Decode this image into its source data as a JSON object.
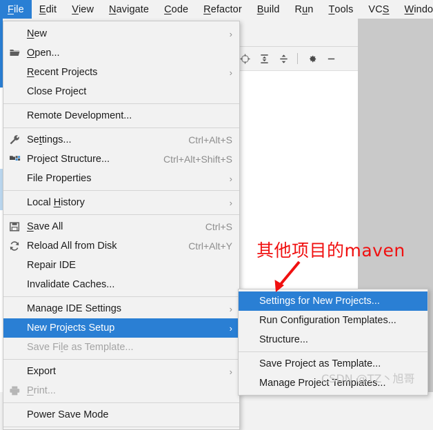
{
  "menubar": {
    "items": [
      {
        "label": "File",
        "mnemonic": "F",
        "active": true
      },
      {
        "label": "Edit",
        "mnemonic": "E",
        "active": false
      },
      {
        "label": "View",
        "mnemonic": "V",
        "active": false
      },
      {
        "label": "Navigate",
        "mnemonic": "N",
        "active": false
      },
      {
        "label": "Code",
        "mnemonic": "C",
        "active": false
      },
      {
        "label": "Refactor",
        "mnemonic": "R",
        "active": false
      },
      {
        "label": "Build",
        "mnemonic": "B",
        "active": false
      },
      {
        "label": "Run",
        "mnemonic": "u",
        "active": false
      },
      {
        "label": "Tools",
        "mnemonic": "T",
        "active": false
      },
      {
        "label": "VCS",
        "mnemonic": "S",
        "active": false
      },
      {
        "label": "Window",
        "mnemonic": "W",
        "active": false
      }
    ]
  },
  "toolbar": {
    "icons": [
      {
        "name": "locate-icon",
        "title": "Select Opened File"
      },
      {
        "name": "expand-all-icon",
        "title": "Expand All"
      },
      {
        "name": "collapse-all-icon",
        "title": "Collapse All"
      },
      {
        "name": "separator",
        "title": ""
      },
      {
        "name": "gear-icon",
        "title": "Options"
      },
      {
        "name": "minimize-icon",
        "title": "Hide"
      }
    ]
  },
  "file_menu": {
    "items": [
      {
        "label": "New",
        "mnemonic": "N",
        "icon": "none",
        "shortcut": "",
        "arrow": true,
        "state": "normal"
      },
      {
        "label": "Open...",
        "mnemonic": "O",
        "icon": "folder-icon",
        "shortcut": "",
        "arrow": false,
        "state": "normal"
      },
      {
        "label": "Recent Projects",
        "mnemonic": "R",
        "icon": "none",
        "shortcut": "",
        "arrow": true,
        "state": "normal"
      },
      {
        "label": "Close Project",
        "mnemonic": "",
        "icon": "none",
        "shortcut": "",
        "arrow": false,
        "state": "normal"
      },
      {
        "separator": true
      },
      {
        "label": "Remote Development...",
        "mnemonic": "",
        "icon": "none",
        "shortcut": "",
        "arrow": false,
        "state": "normal"
      },
      {
        "separator": true
      },
      {
        "label": "Settings...",
        "mnemonic": "t",
        "icon": "wrench-icon",
        "shortcut": "Ctrl+Alt+S",
        "arrow": false,
        "state": "normal"
      },
      {
        "label": "Project Structure...",
        "mnemonic": "",
        "icon": "modules-icon",
        "shortcut": "Ctrl+Alt+Shift+S",
        "arrow": false,
        "state": "normal"
      },
      {
        "label": "File Properties",
        "mnemonic": "",
        "icon": "none",
        "shortcut": "",
        "arrow": true,
        "state": "normal"
      },
      {
        "separator": true
      },
      {
        "label": "Local History",
        "mnemonic": "H",
        "icon": "none",
        "shortcut": "",
        "arrow": true,
        "state": "normal"
      },
      {
        "separator": true
      },
      {
        "label": "Save All",
        "mnemonic": "S",
        "icon": "save-icon",
        "shortcut": "Ctrl+S",
        "arrow": false,
        "state": "normal"
      },
      {
        "label": "Reload All from Disk",
        "mnemonic": "",
        "icon": "reload-icon",
        "shortcut": "Ctrl+Alt+Y",
        "arrow": false,
        "state": "normal"
      },
      {
        "label": "Repair IDE",
        "mnemonic": "",
        "icon": "none",
        "shortcut": "",
        "arrow": false,
        "state": "normal"
      },
      {
        "label": "Invalidate Caches...",
        "mnemonic": "",
        "icon": "none",
        "shortcut": "",
        "arrow": false,
        "state": "normal"
      },
      {
        "separator": true
      },
      {
        "label": "Manage IDE Settings",
        "mnemonic": "",
        "icon": "none",
        "shortcut": "",
        "arrow": true,
        "state": "normal"
      },
      {
        "label": "New Projects Setup",
        "mnemonic": "",
        "icon": "none",
        "shortcut": "",
        "arrow": true,
        "state": "selected"
      },
      {
        "label": "Save File as Template...",
        "mnemonic": "l",
        "icon": "none",
        "shortcut": "",
        "arrow": false,
        "state": "disabled"
      },
      {
        "separator": true
      },
      {
        "label": "Export",
        "mnemonic": "",
        "icon": "none",
        "shortcut": "",
        "arrow": true,
        "state": "normal"
      },
      {
        "label": "Print...",
        "mnemonic": "P",
        "icon": "print-icon",
        "shortcut": "",
        "arrow": false,
        "state": "disabled"
      },
      {
        "separator": true
      },
      {
        "label": "Power Save Mode",
        "mnemonic": "",
        "icon": "none",
        "shortcut": "",
        "arrow": false,
        "state": "normal"
      },
      {
        "separator": true
      }
    ]
  },
  "submenu": {
    "items": [
      {
        "label": "Settings for New Projects...",
        "state": "selected"
      },
      {
        "label": "Run Configuration Templates...",
        "state": "normal"
      },
      {
        "label": "Structure...",
        "state": "normal"
      },
      {
        "separator": true
      },
      {
        "label": "Save Project as Template...",
        "state": "normal"
      },
      {
        "label": "Manage Project Templates...",
        "state": "normal"
      }
    ]
  },
  "annotation": {
    "text": "其他项目的maven",
    "color": "#f01010"
  },
  "watermark": {
    "text": "CSDN @TZ丶旭哥"
  },
  "colors": {
    "selection_blue": "#2a7fd4",
    "menu_bg": "#f2f2f2",
    "ide_grey": "#c9c9c9",
    "shortcut_grey": "#8d8d8d",
    "disabled_grey": "#a4a4a4"
  }
}
